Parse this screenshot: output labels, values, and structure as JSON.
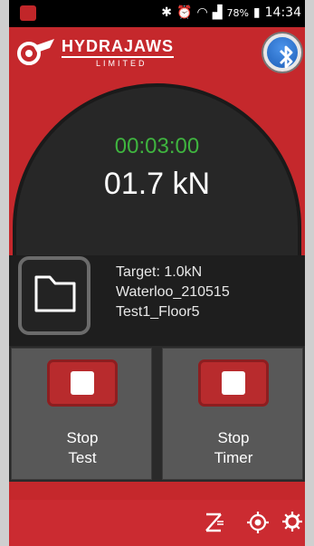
{
  "status_bar": {
    "battery": "78%",
    "time": "14:34"
  },
  "app": {
    "brand": "HYDRAJAWS",
    "subtitle": "LIMITED"
  },
  "readout": {
    "timer": "00:03:00",
    "force": "01.7 kN"
  },
  "info": {
    "target": "Target: 1.0kN",
    "project": "Waterloo_210515",
    "test": "Test1_Floor5"
  },
  "actions": {
    "stop_test": [
      "Stop",
      "Test"
    ],
    "stop_timer": [
      "Stop",
      "Timer"
    ]
  },
  "icons": {
    "bluetooth": "bluetooth-icon",
    "folder": "folder-icon",
    "zero": "zero-icon",
    "locate": "locate-icon",
    "settings": "settings-icon"
  }
}
